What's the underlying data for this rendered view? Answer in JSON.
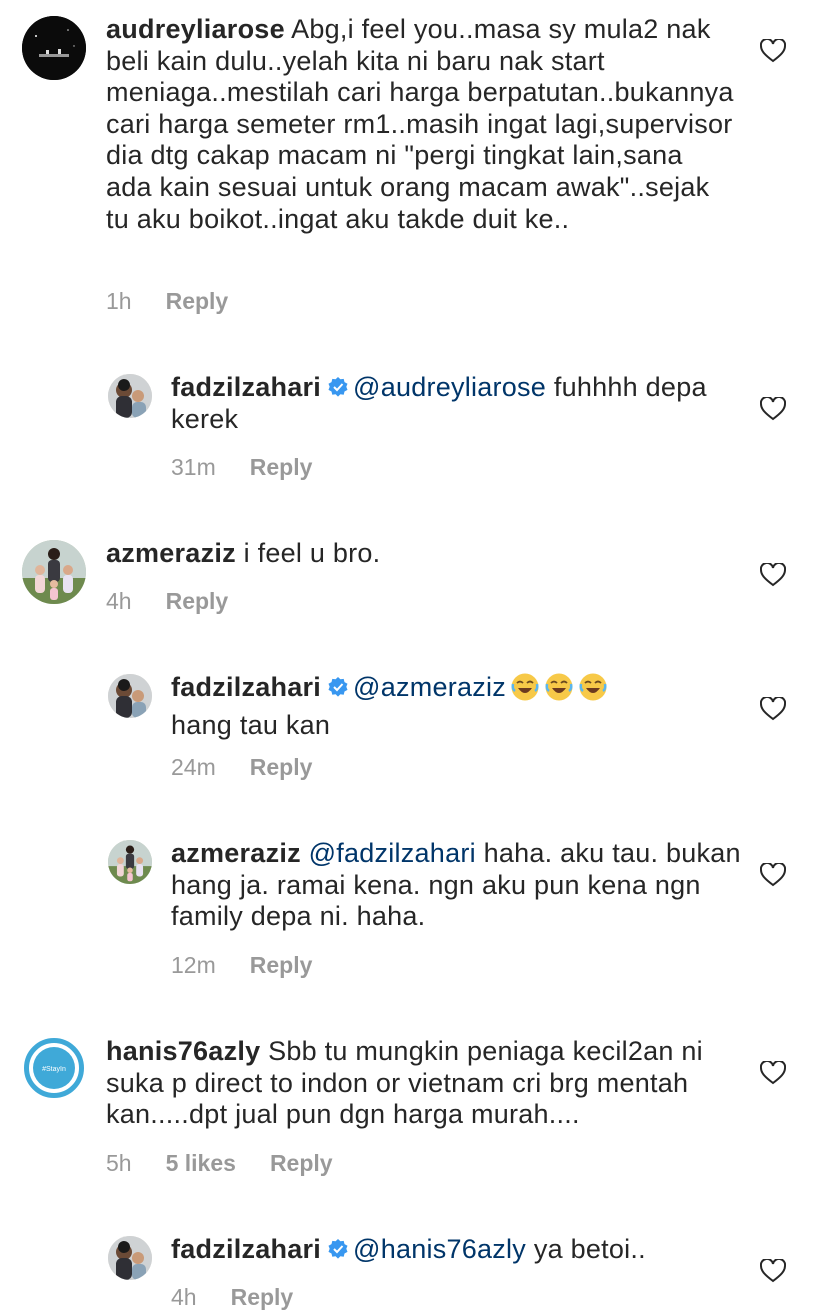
{
  "comments": [
    {
      "username": "audreyliarose",
      "text": "Abg,i feel you..masa sy mula2 nak beli kain dulu..yelah kita ni baru nak start meniaga..mestilah cari harga berpatutan..bukannya cari harga semeter rm1..masih ingat lagi,supervisor dia dtg cakap macam ni \"pergi tingkat lain,sana ada kain sesuai untuk orang macam awak\"..sejak tu aku boikot..ingat aku takde duit ke..",
      "time": "1h",
      "reply_label": "Reply"
    },
    {
      "username": "fadzilzahari",
      "mention": "@audreyliarose",
      "text": "fuhhhh depa kerek",
      "time": "31m",
      "reply_label": "Reply"
    },
    {
      "username": "azmeraziz",
      "text": "i feel u bro.",
      "time": "4h",
      "reply_label": "Reply"
    },
    {
      "username": "fadzilzahari",
      "mention": "@azmeraziz",
      "text": "hang tau kan",
      "time": "24m",
      "reply_label": "Reply"
    },
    {
      "username": "azmeraziz",
      "mention": "@fadzilzahari",
      "text": "haha. aku tau. bukan hang ja. ramai kena. ngn aku pun kena ngn family depa ni. haha.",
      "time": "12m",
      "reply_label": "Reply"
    },
    {
      "username": "hanis76azly",
      "text": "Sbb tu mungkin peniaga kecil2an ni suka p direct to indon or vietnam cri brg mentah kan.....dpt jual pun dgn harga murah....",
      "time": "5h",
      "likes": "5 likes",
      "reply_label": "Reply"
    },
    {
      "username": "fadzilzahari",
      "mention": "@hanis76azly",
      "text": "ya betoi..",
      "time": "4h",
      "reply_label": "Reply"
    }
  ],
  "avatar_badge_text": "#StayIn",
  "icons": {
    "like": "heart-outline-icon",
    "verified": "verified-badge-icon",
    "emoji": "face-with-tears-of-joy"
  },
  "colors": {
    "text": "#262626",
    "mention": "#003569",
    "meta": "#999999",
    "verified": "#3897f0",
    "stayin_ring": "#3fa9d8"
  }
}
